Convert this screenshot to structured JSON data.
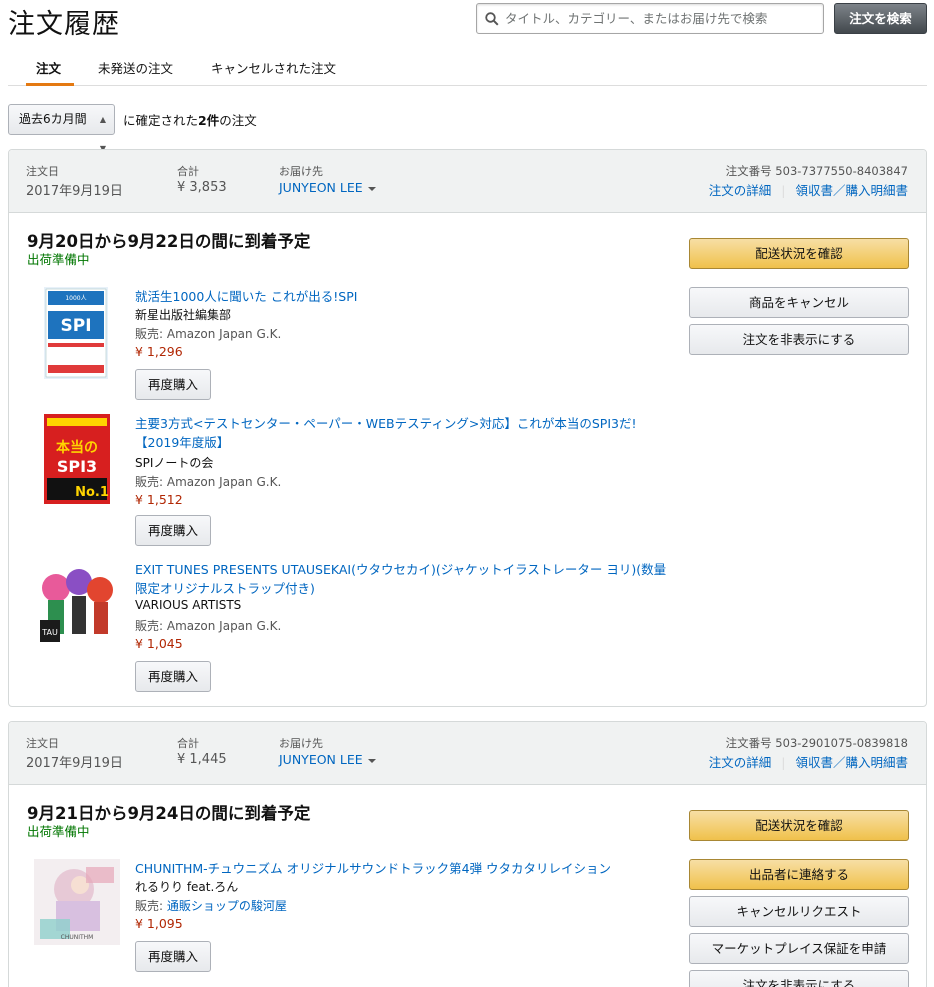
{
  "page": {
    "title": "注文履歴",
    "search_placeholder": "タイトル、カテゴリー、またはお届け先で検索",
    "search_button": "注文を検索"
  },
  "tabs": [
    "注文",
    "未発送の注文",
    "キャンセルされた注文"
  ],
  "filter": {
    "range": "過去6カ月間",
    "text_before": "に確定された",
    "count": "2件",
    "text_after": "の注文"
  },
  "labels": {
    "order_date": "注文日",
    "total": "合計",
    "ship_to": "お届け先",
    "order_details": "注文の詳細",
    "invoice": "領収書／購入明細書",
    "rebuy": "再度購入",
    "seller_prefix": "販売: "
  },
  "orders": [
    {
      "date": "2017年9月19日",
      "total": "¥ 3,853",
      "recipient": "JUNYEON LEE",
      "order_number": "注文番号 503-7377550-8403847",
      "delivery": "9月20日から9月22日の間に到着予定",
      "status": "出荷準備中",
      "buttons": [
        "配送状況を確認",
        "商品をキャンセル",
        "注文を非表示にする"
      ],
      "items": [
        {
          "title": "就活生1000人に聞いた これが出る!SPI",
          "author": "新星出版社編集部",
          "seller": "Amazon Japan G.K.",
          "price": "¥ 1,296",
          "thumb_text": "SPI",
          "thumb_top": "就活生1000人に聞いた"
        },
        {
          "title": "主要3方式<テストセンター・ペーパー・WEBテスティング>対応】これが本当のSPI3だ! 【2019年度版】",
          "author": "SPIノートの会",
          "seller": "Amazon Japan G.K.",
          "price": "¥ 1,512",
          "thumb_text": "本当のSPI3",
          "thumb_top": "No.1"
        },
        {
          "title": "EXIT TUNES PRESENTS UTAUSEKAI(ウタウセカイ)(ジャケットイラストレーター ヨリ)(数量限定オリジナルストラップ付き)",
          "author": "VARIOUS ARTISTS",
          "seller": "Amazon Japan G.K.",
          "price": "¥ 1,045",
          "thumb_text": "UTAU",
          "thumb_top": ""
        }
      ]
    },
    {
      "date": "2017年9月19日",
      "total": "¥ 1,445",
      "recipient": "JUNYEON LEE",
      "order_number": "注文番号 503-2901075-0839818",
      "delivery": "9月21日から9月24日の間に到着予定",
      "status": "出荷準備中",
      "buttons": [
        "配送状況を確認",
        "出品者に連絡する",
        "キャンセルリクエスト",
        "マーケットプレイス保証を申請",
        "注文を非表示にする"
      ],
      "items": [
        {
          "title": "CHUNITHM-チュウニズム オリジナルサウンドトラック第4弾 ウタカタリレイション",
          "author": "れるりり feat.ろん",
          "seller": "通販ショップの駿河屋",
          "price": "¥ 1,095",
          "thumb_text": "CHUNITHM",
          "thumb_top": ""
        }
      ]
    }
  ],
  "colors": {
    "accent": "#e47911",
    "link": "#0066c0",
    "price": "#b12704",
    "status": "#007600",
    "primary_button": "#f0c14b"
  }
}
